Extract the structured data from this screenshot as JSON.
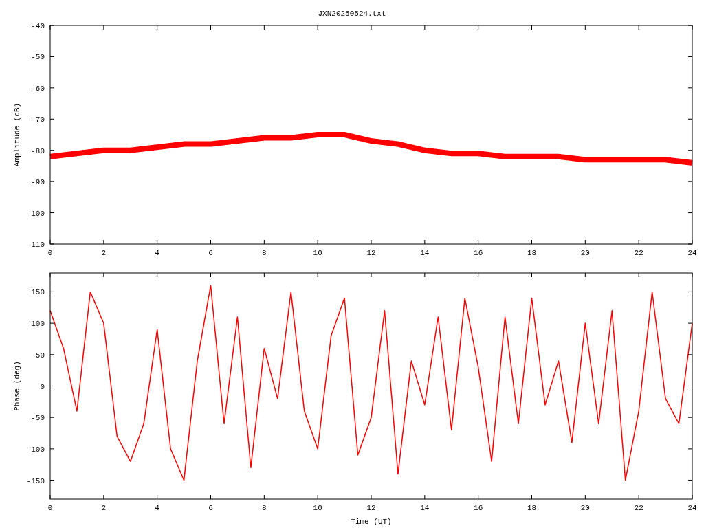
{
  "title": "JXN20250524.txt",
  "charts": [
    {
      "chart_data": {
        "type": "line",
        "ylabel": "Amplitude (dB)",
        "xlim": [
          0,
          24
        ],
        "ylim": [
          -110,
          -40
        ],
        "xticks": [
          0,
          2,
          4,
          6,
          8,
          10,
          12,
          14,
          16,
          18,
          20,
          22,
          24
        ],
        "yticks": [
          -40,
          -50,
          -60,
          -70,
          -80,
          -90,
          -100,
          -110
        ],
        "x": [
          0,
          1,
          2,
          3,
          4,
          5,
          6,
          7,
          8,
          9,
          10,
          11,
          12,
          13,
          14,
          15,
          16,
          17,
          18,
          19,
          20,
          21,
          22,
          23,
          24
        ],
        "series": [
          {
            "color": "#ff0000",
            "values": [
              -82,
              -81,
              -80,
              -80,
              -79,
              -78,
              -78,
              -77,
              -76,
              -76,
              -75,
              -75,
              -77,
              -78,
              -80,
              -81,
              -81,
              -82,
              -82,
              -82,
              -83,
              -83,
              -83,
              -83,
              -84
            ]
          }
        ]
      }
    },
    {
      "chart_data": {
        "type": "line",
        "xlabel": "Time (UT)",
        "ylabel": "Phase (deg)",
        "xlim": [
          0,
          24
        ],
        "ylim": [
          -180,
          180
        ],
        "xticks": [
          0,
          2,
          4,
          6,
          8,
          10,
          12,
          14,
          16,
          18,
          20,
          22,
          24
        ],
        "yticks": [
          150,
          100,
          50,
          0,
          -50,
          -100,
          -150
        ],
        "x": [
          0,
          0.5,
          1,
          1.5,
          2,
          2.5,
          3,
          3.5,
          4,
          4.5,
          5,
          5.5,
          6,
          6.5,
          7,
          7.5,
          8,
          8.5,
          9,
          9.5,
          10,
          10.5,
          11,
          11.5,
          12,
          12.5,
          13,
          13.5,
          14,
          14.5,
          15,
          15.5,
          16,
          16.5,
          17,
          17.5,
          18,
          18.5,
          19,
          19.5,
          20,
          20.5,
          21,
          21.5,
          22,
          22.5,
          23,
          23.5,
          24
        ],
        "series": [
          {
            "color": "#ff0000",
            "values": [
              120,
              60,
              -40,
              150,
              100,
              -80,
              -120,
              -60,
              90,
              -100,
              -150,
              40,
              160,
              -60,
              110,
              -130,
              60,
              -20,
              150,
              -40,
              -100,
              80,
              140,
              -110,
              -50,
              120,
              -140,
              40,
              -30,
              110,
              -70,
              140,
              30,
              -120,
              110,
              -60,
              140,
              -30,
              40,
              -90,
              100,
              -60,
              120,
              -150,
              -40,
              150,
              -20,
              -60,
              100
            ]
          }
        ]
      }
    }
  ]
}
